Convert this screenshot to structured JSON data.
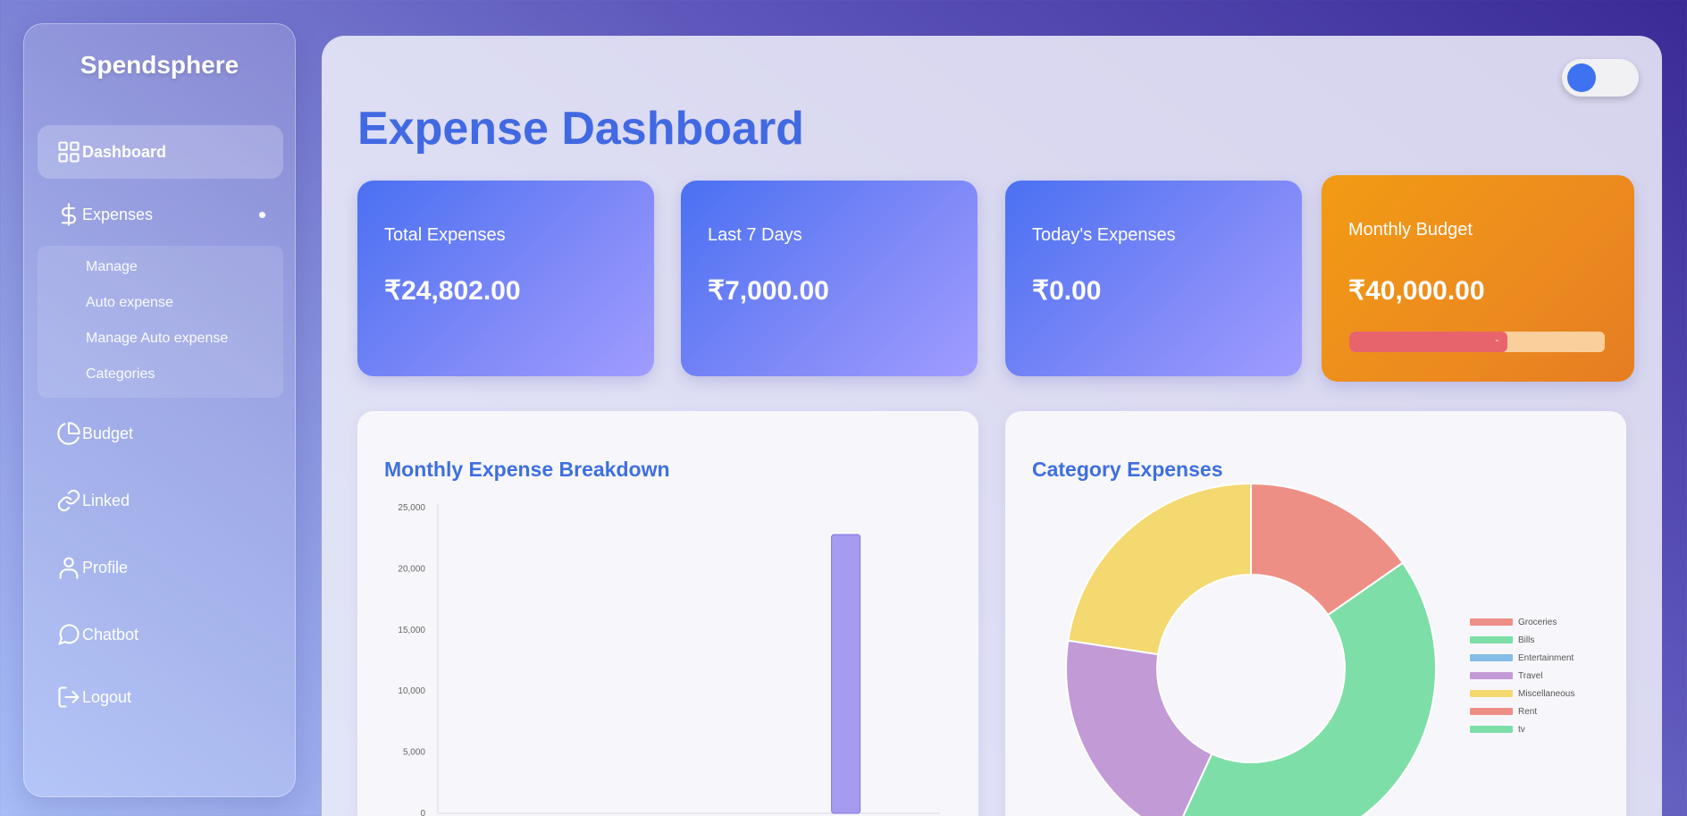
{
  "brand": "Spendsphere",
  "sidebar": {
    "items": [
      {
        "label": "Dashboard",
        "icon": "grid-icon"
      },
      {
        "label": "Expenses",
        "icon": "dollar-icon"
      },
      {
        "label": "Budget",
        "icon": "pie-chart-icon"
      },
      {
        "label": "Linked",
        "icon": "link-icon"
      },
      {
        "label": "Profile",
        "icon": "user-icon"
      },
      {
        "label": "Chatbot",
        "icon": "chat-bubble-icon"
      },
      {
        "label": "Logout",
        "icon": "logout-icon"
      }
    ],
    "submenu": [
      "Manage",
      "Auto expense",
      "Manage Auto expense",
      "Categories"
    ]
  },
  "page_title": "Expense Dashboard",
  "cards": [
    {
      "label": "Total Expenses",
      "value": "₹24,802.00"
    },
    {
      "label": "Last 7 Days",
      "value": "₹7,000.00"
    },
    {
      "label": "Today's Expenses",
      "value": "₹0.00"
    },
    {
      "label": "Monthly Budget",
      "value": "₹40,000.00"
    }
  ],
  "budget_progress": {
    "fraction": 0.62,
    "label": "-"
  },
  "colors": {
    "accent": "#4169e1",
    "bar": "#a59cf0",
    "card_blue": "#4a70f2",
    "card_orange": "#f29b14"
  },
  "chart_data": [
    {
      "type": "bar",
      "title": "Monthly Expense Breakdown",
      "yticks": [
        "25,000",
        "20,000",
        "15,000",
        "10,000",
        "5,000",
        "0"
      ],
      "ylim": [
        0,
        25000
      ],
      "slots": 8,
      "values": [
        0,
        0,
        0,
        0,
        0,
        0,
        22800,
        0
      ],
      "grid": false
    },
    {
      "type": "pie",
      "title": "Category Expenses",
      "donut": true,
      "legend_position": "right",
      "labels": [
        "Groceries",
        "Bills",
        "Entertainment",
        "Travel",
        "Miscellaneous",
        "Rent",
        "tv"
      ],
      "colors": [
        "#ee8f86",
        "#7ddea8",
        "#84bde6",
        "#c29ad6",
        "#f4d870",
        "#ee8f86",
        "#7ddea8"
      ],
      "values": [
        3800,
        10300,
        0,
        5100,
        5600,
        0,
        0
      ]
    }
  ]
}
